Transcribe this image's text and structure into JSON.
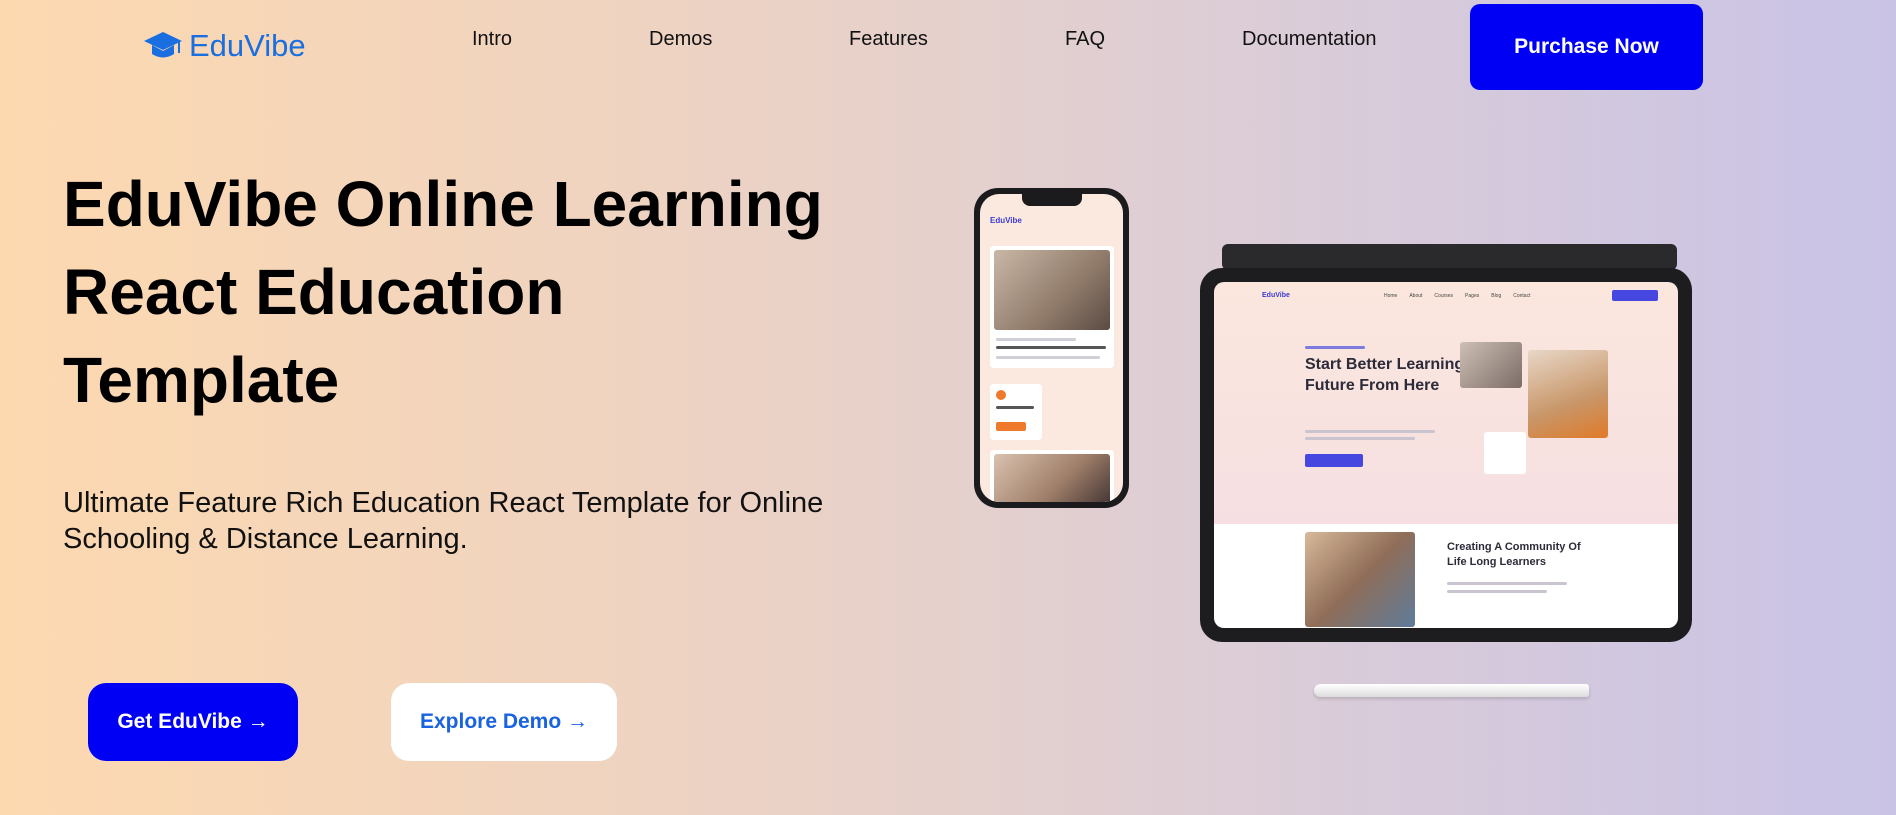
{
  "brand": {
    "logo_text": "EduVibe",
    "icon": "graduation-cap-icon",
    "color": "#1a6fe0"
  },
  "nav": {
    "items": [
      {
        "label": "Intro"
      },
      {
        "label": "Demos"
      },
      {
        "label": "Features"
      },
      {
        "label": "FAQ"
      },
      {
        "label": "Documentation"
      }
    ],
    "purchase_label": "Purchase Now"
  },
  "hero": {
    "title_line1": "EduVibe Online Learning",
    "title_line2": "React Education",
    "title_line3": "Template",
    "subtitle": "Ultimate Feature Rich Education React Template for Online Schooling & Distance Learning.",
    "primary_cta": "Get EduVibe →",
    "secondary_cta": "Explore Demo →"
  },
  "mockup": {
    "phone_logo": "EduVibe",
    "tablet_logo": "EduVibe",
    "tablet_nav": [
      "Home",
      "About",
      "Courses",
      "Pages",
      "Blog",
      "Contact"
    ],
    "tablet_heading": "Start Better Learning Future From Here",
    "tablet_subheading": "Creating A Community Of Life Long Learners"
  },
  "colors": {
    "accent": "#0000f5",
    "link": "#1a63e0",
    "bg_start": "#fdd9b0",
    "bg_end": "#c9c3e6"
  }
}
